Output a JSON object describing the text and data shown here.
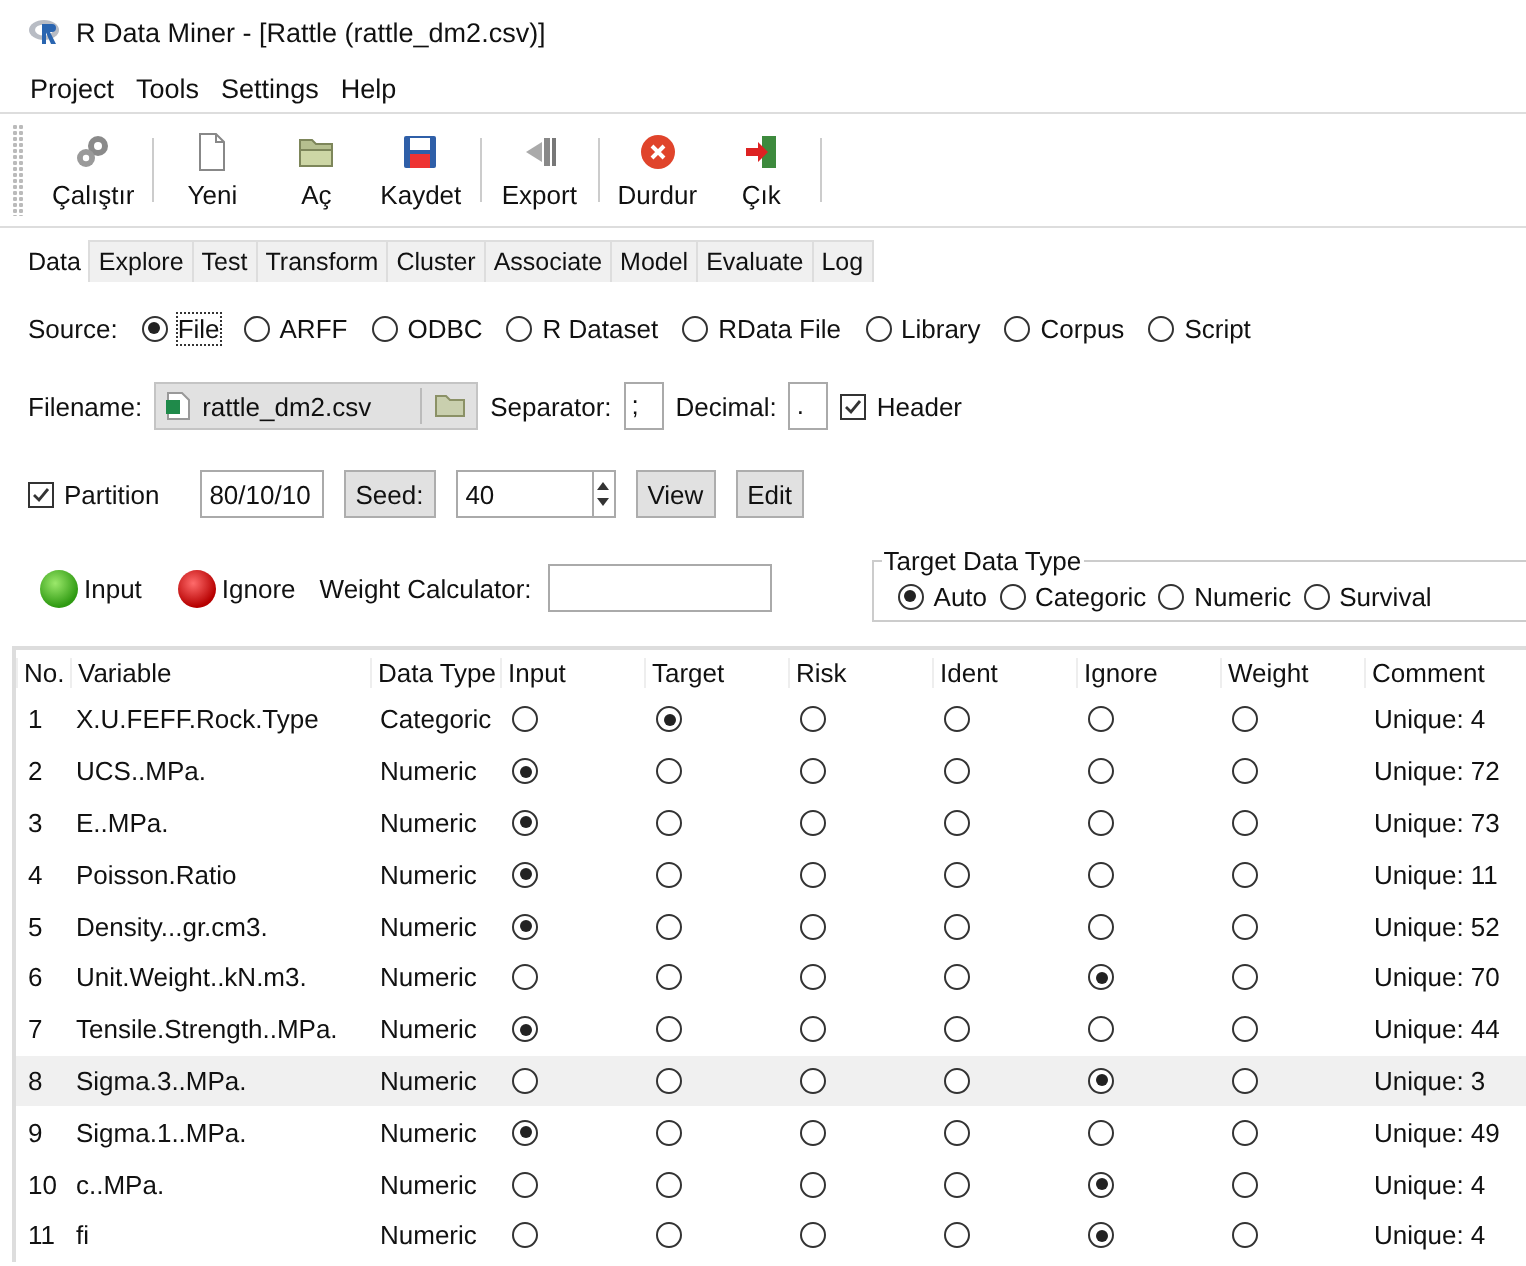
{
  "window": {
    "title": "R Data Miner - [Rattle (rattle_dm2.csv)]"
  },
  "menu": [
    "Project",
    "Tools",
    "Settings",
    "Help"
  ],
  "toolbar": [
    {
      "label": "Çalıştır",
      "kind": "gear"
    },
    {
      "label": "Yeni",
      "kind": "new"
    },
    {
      "label": "Aç",
      "kind": "open"
    },
    {
      "label": "Kaydet",
      "kind": "save"
    },
    {
      "label": "Export",
      "kind": "export"
    },
    {
      "label": "Durdur",
      "kind": "stop"
    },
    {
      "label": "Çık",
      "kind": "exit"
    }
  ],
  "tabs": [
    {
      "label": "Data",
      "selected": true
    },
    {
      "label": "Explore",
      "selected": false
    },
    {
      "label": "Test",
      "selected": false
    },
    {
      "label": "Transform",
      "selected": false
    },
    {
      "label": "Cluster",
      "selected": false
    },
    {
      "label": "Associate",
      "selected": false
    },
    {
      "label": "Model",
      "selected": false
    },
    {
      "label": "Evaluate",
      "selected": false
    },
    {
      "label": "Log",
      "selected": false
    }
  ],
  "source": {
    "label": "Source:",
    "options": [
      {
        "label": "File",
        "selected": true
      },
      {
        "label": "ARFF",
        "selected": false
      },
      {
        "label": "ODBC",
        "selected": false
      },
      {
        "label": "R Dataset",
        "selected": false
      },
      {
        "label": "RData File",
        "selected": false
      },
      {
        "label": "Library",
        "selected": false
      },
      {
        "label": "Corpus",
        "selected": false
      },
      {
        "label": "Script",
        "selected": false
      }
    ]
  },
  "file": {
    "label": "Filename:",
    "value": "rattle_dm2.csv",
    "separator_label": "Separator:",
    "separator": ";",
    "decimal_label": "Decimal:",
    "decimal": ".",
    "header": {
      "label": "Header",
      "checked": true
    }
  },
  "partition": {
    "label": "Partition",
    "checked": true,
    "value": "80/10/10",
    "seed_button": "Seed:",
    "seed": "40",
    "view_button": "View",
    "edit_button": "Edit"
  },
  "roles": {
    "input": "Input",
    "ignore": "Ignore",
    "weight_label": "Weight Calculator:"
  },
  "target_type": {
    "title": "Target Data Type",
    "options": [
      {
        "label": "Auto",
        "selected": true
      },
      {
        "label": "Categoric",
        "selected": false
      },
      {
        "label": "Numeric",
        "selected": false
      },
      {
        "label": "Survival",
        "selected": false
      }
    ]
  },
  "table": {
    "columns": [
      "No.",
      "Variable",
      "Data Type",
      "Input",
      "Target",
      "Risk",
      "Ident",
      "Ignore",
      "Weight",
      "Comment"
    ],
    "rows": [
      {
        "no": "1",
        "variable": "X.U.FEFF.Rock.Type",
        "type": "Categoric",
        "input": false,
        "target": true,
        "risk": false,
        "ident": false,
        "ignore": false,
        "weight": false,
        "comment": "Unique: 4",
        "selected": false
      },
      {
        "no": "2",
        "variable": "UCS..MPa.",
        "type": "Numeric",
        "input": true,
        "target": false,
        "risk": false,
        "ident": false,
        "ignore": false,
        "weight": false,
        "comment": "Unique: 72",
        "selected": false
      },
      {
        "no": "3",
        "variable": "E..MPa.",
        "type": "Numeric",
        "input": true,
        "target": false,
        "risk": false,
        "ident": false,
        "ignore": false,
        "weight": false,
        "comment": "Unique: 73",
        "selected": false
      },
      {
        "no": "4",
        "variable": "Poisson.Ratio",
        "type": "Numeric",
        "input": true,
        "target": false,
        "risk": false,
        "ident": false,
        "ignore": false,
        "weight": false,
        "comment": "Unique: 11",
        "selected": false
      },
      {
        "no": "5",
        "variable": "Density...gr.cm3.",
        "type": "Numeric",
        "input": true,
        "target": false,
        "risk": false,
        "ident": false,
        "ignore": false,
        "weight": false,
        "comment": "Unique: 52",
        "selected": false
      },
      {
        "no": "6",
        "variable": "Unit.Weight..kN.m3.",
        "type": "Numeric",
        "input": false,
        "target": false,
        "risk": false,
        "ident": false,
        "ignore": true,
        "weight": false,
        "comment": "Unique: 70",
        "selected": false
      },
      {
        "no": "7",
        "variable": "Tensile.Strength..MPa.",
        "type": "Numeric",
        "input": true,
        "target": false,
        "risk": false,
        "ident": false,
        "ignore": false,
        "weight": false,
        "comment": "Unique: 44",
        "selected": false
      },
      {
        "no": "8",
        "variable": "Sigma.3..MPa.",
        "type": "Numeric",
        "input": false,
        "target": false,
        "risk": false,
        "ident": false,
        "ignore": true,
        "weight": false,
        "comment": "Unique: 3",
        "selected": true
      },
      {
        "no": "9",
        "variable": "Sigma.1..MPa.",
        "type": "Numeric",
        "input": true,
        "target": false,
        "risk": false,
        "ident": false,
        "ignore": false,
        "weight": false,
        "comment": "Unique: 49",
        "selected": false
      },
      {
        "no": "10",
        "variable": "c..MPa.",
        "type": "Numeric",
        "input": false,
        "target": false,
        "risk": false,
        "ident": false,
        "ignore": true,
        "weight": false,
        "comment": "Unique: 4",
        "selected": false
      },
      {
        "no": "11",
        "variable": "fi",
        "type": "Numeric",
        "input": false,
        "target": false,
        "risk": false,
        "ident": false,
        "ignore": true,
        "weight": false,
        "comment": "Unique: 4",
        "selected": false
      }
    ]
  }
}
